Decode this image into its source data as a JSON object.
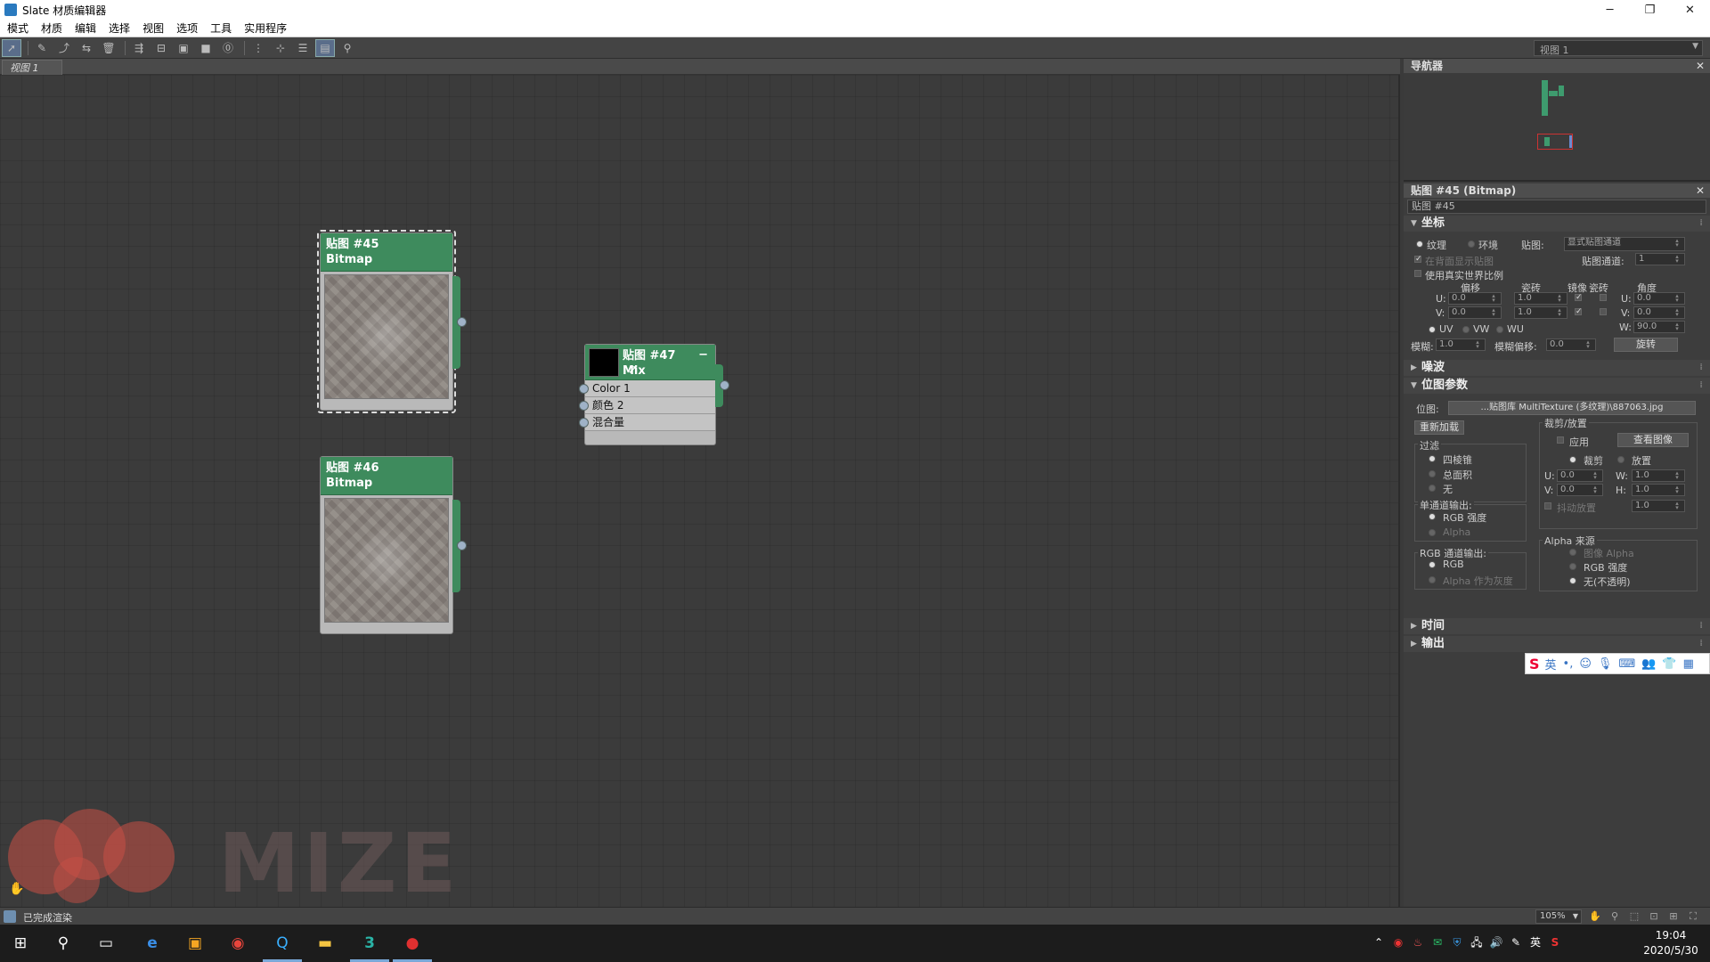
{
  "window": {
    "title": "Slate 材质编辑器",
    "minimize": "─",
    "restore": "❐",
    "close": "✕"
  },
  "menu": [
    "模式",
    "材质",
    "编辑",
    "选择",
    "视图",
    "选项",
    "工具",
    "实用程序"
  ],
  "toolbar": {
    "view_dropdown": "视图 1"
  },
  "view": {
    "tab_label": "视图 1"
  },
  "nodes": {
    "n45": {
      "title": "贴图 #45",
      "type": "Bitmap"
    },
    "n46": {
      "title": "贴图 #46",
      "type": "Bitmap"
    },
    "n47": {
      "title": "贴图 #47",
      "type": "Mix",
      "slots": [
        "Color 1",
        "颜色 2",
        "混合量"
      ]
    }
  },
  "navigator": {
    "title": "导航器"
  },
  "params": {
    "title": "贴图 #45 (Bitmap)",
    "name_field": "贴图 #45",
    "coords": {
      "heading": "坐标",
      "texture": "纹理",
      "environ": "环境",
      "map_label": "贴图:",
      "map_value": "显式贴图通道",
      "show_back": "在背面显示贴图",
      "channel_label": "贴图通道:",
      "channel_value": "1",
      "real_world": "使用真实世界比例",
      "col_offset": "偏移",
      "col_tiling": "瓷砖",
      "col_mirror": "镜像",
      "col_tile2": "瓷砖",
      "col_angle": "角度",
      "u": "U:",
      "v": "V:",
      "w": "W:",
      "u_offset": "0.0",
      "v_offset": "0.0",
      "u_tiling": "1.0",
      "v_tiling": "1.0",
      "u_angle": "0.0",
      "v_angle": "0.0",
      "w_angle": "90.0",
      "uv": "UV",
      "vw": "VW",
      "wu": "WU",
      "blur_label": "模糊:",
      "blur_value": "1.0",
      "blur_offset_label": "模糊偏移:",
      "blur_offset_value": "0.0",
      "rotate_btn": "旋转"
    },
    "noise": {
      "heading": "噪波"
    },
    "bitmap": {
      "heading": "位图参数",
      "path_label": "位图:",
      "path_value": "...贴图库 MultiTexture (多纹理)\\887063.jpg",
      "reload_btn": "重新加载",
      "crop_group": "裁剪/放置",
      "apply": "应用",
      "view_image_btn": "查看图像",
      "crop": "裁剪",
      "place": "放置",
      "u": "U:",
      "v": "V:",
      "w": "W:",
      "h": "H:",
      "u_val": "0.0",
      "v_val": "0.0",
      "w_val": "1.0",
      "h_val": "1.0",
      "jitter": "抖动放置",
      "jitter_val": "1.0",
      "filter_group": "过滤",
      "pyramidal": "四棱锥",
      "summed": "总面积",
      "none": "无",
      "mono_group": "单通道输出:",
      "rgb_intensity": "RGB 强度",
      "alpha": "Alpha",
      "rgb_group": "RGB 通道输出:",
      "rgb": "RGB",
      "alpha_gray": "Alpha 作为灰度",
      "alpha_src_group": "Alpha 来源",
      "img_alpha": "图像 Alpha",
      "rgb_intensity2": "RGB 强度",
      "opaque": "无(不透明)"
    },
    "time": {
      "heading": "时间"
    },
    "output": {
      "heading": "输出"
    }
  },
  "status": {
    "text": "已完成渲染",
    "zoom": "105%"
  },
  "watermark": {
    "text": "MIZE"
  },
  "ime": {
    "lang": "英"
  },
  "taskbar": {
    "time": "19:04",
    "date": "2020/5/30",
    "ime_lang": "英"
  }
}
